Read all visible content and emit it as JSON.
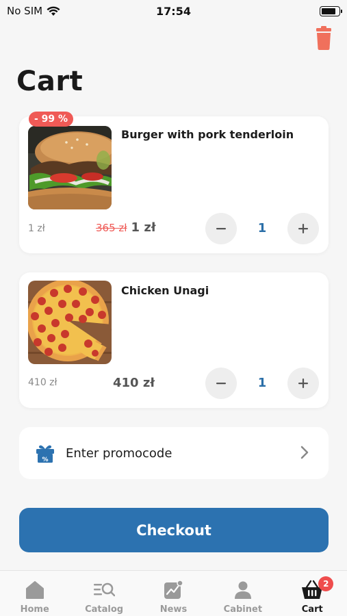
{
  "status_bar": {
    "carrier": "No SIM",
    "time": "17:54",
    "battery_level": 0.85
  },
  "page": {
    "title": "Cart"
  },
  "colors": {
    "accent": "#2c72b0",
    "discount": "#ef5a56",
    "badge": "#ef4d4d",
    "qty": "#2b6fa8"
  },
  "cart_items": [
    {
      "name": "Burger with pork tenderloin",
      "badge": "- 99 %",
      "unit_price": "1 zł",
      "old_price": "365 zł",
      "price": "1 zł",
      "quantity": "1",
      "image": "burger-photo"
    },
    {
      "name": "Chicken Unagi",
      "unit_price": "410 zł",
      "price": "410 zł",
      "quantity": "1",
      "image": "pizza-photo"
    }
  ],
  "promo": {
    "label": "Enter promocode",
    "icon": "gift-icon"
  },
  "checkout": {
    "label": "Checkout"
  },
  "tab_bar": {
    "tabs": [
      {
        "label": "Home",
        "icon": "home-icon"
      },
      {
        "label": "Catalog",
        "icon": "catalog-icon"
      },
      {
        "label": "News",
        "icon": "news-icon"
      },
      {
        "label": "Cabinet",
        "icon": "user-icon"
      },
      {
        "label": "Cart",
        "icon": "basket-icon",
        "badge": "2",
        "active": true
      }
    ]
  }
}
